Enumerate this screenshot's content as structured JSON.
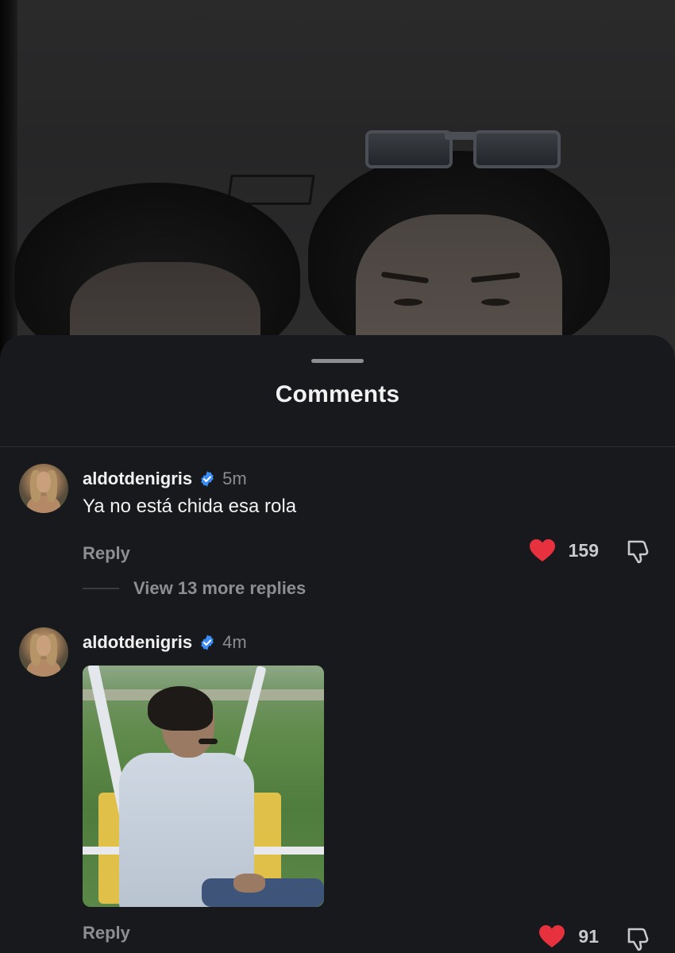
{
  "sheet": {
    "title": "Comments"
  },
  "comments": [
    {
      "username": "aldotdenigris",
      "verified": true,
      "time": "5m",
      "text": "Ya no está chida esa rola",
      "reply_label": "Reply",
      "likes": "159",
      "liked": true,
      "view_replies_label": "View 13 more replies"
    },
    {
      "username": "aldotdenigris",
      "verified": true,
      "time": "4m",
      "attachment": "gif",
      "reply_label": "Reply",
      "likes": "91",
      "liked": true
    }
  ],
  "colors": {
    "sheet_bg": "#18191c",
    "like_red": "#e8313f",
    "verified_blue": "#3b8cf5",
    "muted_text": "#8d8e92"
  },
  "icons": {
    "like": "heart-icon",
    "dislike": "thumbs-down-outline-icon",
    "verified": "verified-badge-icon"
  }
}
